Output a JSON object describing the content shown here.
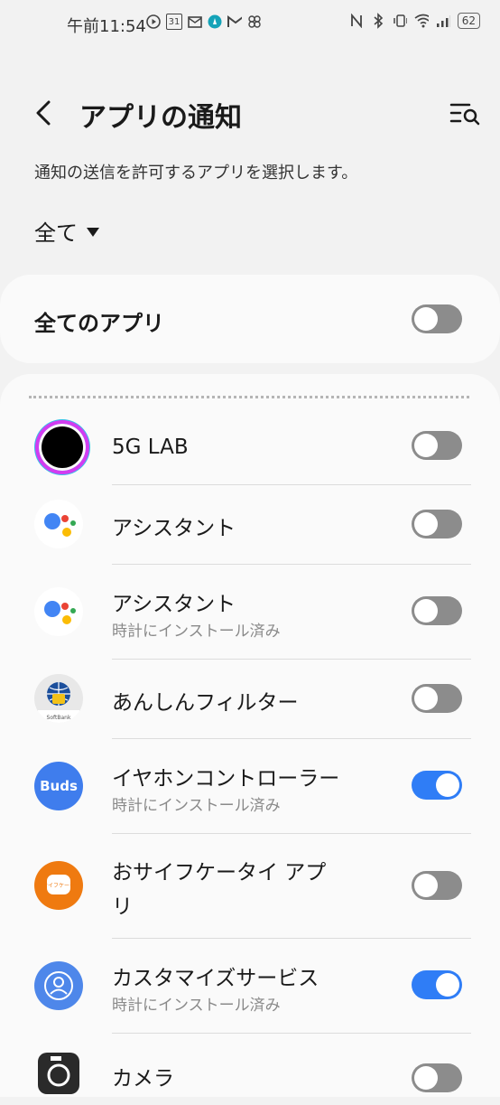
{
  "status_bar": {
    "time": "午前11:54",
    "calendar_day": "31",
    "battery": "62"
  },
  "header": {
    "title": "アプリの通知"
  },
  "description": "通知の送信を許可するアプリを選択します。",
  "filter": {
    "selected": "全て"
  },
  "all_apps": {
    "label": "全てのアプリ",
    "enabled": false
  },
  "apps": [
    {
      "name": "5G LAB",
      "subtitle": "",
      "icon": "5g-lab-icon",
      "enabled": false
    },
    {
      "name": "アシスタント",
      "subtitle": "",
      "icon": "assistant-icon",
      "enabled": false
    },
    {
      "name": "アシスタント",
      "subtitle": "時計にインストール済み",
      "icon": "assistant-icon",
      "enabled": false
    },
    {
      "name": "あんしんフィルター",
      "subtitle": "",
      "icon": "anshin-filter-icon",
      "icon_text": "SoftBank",
      "enabled": false
    },
    {
      "name": "イヤホンコントローラー",
      "subtitle": "時計にインストール済み",
      "icon": "buds-icon",
      "icon_text": "Buds",
      "enabled": true
    },
    {
      "name": "おサイフケータイ アプ",
      "name_line2": "リ",
      "subtitle": "",
      "icon": "osaifu-keitai-icon",
      "icon_text": "おサイフケータイ",
      "enabled": false
    },
    {
      "name": "カスタマイズサービス",
      "subtitle": "時計にインストール済み",
      "icon": "customize-service-icon",
      "enabled": true
    },
    {
      "name": "カメラ",
      "subtitle": "",
      "icon": "camera-icon",
      "enabled": false
    }
  ],
  "colors": {
    "accent": "#2f7df6",
    "toggle_off": "#8c8c8c",
    "background": "#f2f2f2",
    "card": "#fafafa"
  }
}
